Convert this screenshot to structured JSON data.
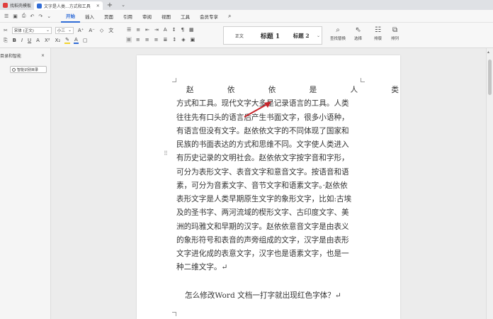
{
  "tabs": [
    {
      "label": "找稻壳模板",
      "active": false,
      "icon_color": "#e03d3d"
    },
    {
      "label": "文字是人类...方式和工具",
      "active": true,
      "icon_color": "#2f6bd6"
    }
  ],
  "menu": [
    "开始",
    "插入",
    "页面",
    "引用",
    "审阅",
    "视图",
    "工具",
    "会员专享"
  ],
  "active_menu": "开始",
  "ribbon": {
    "font_name": "宋体 (正文)",
    "font_size": "小三",
    "styles": [
      {
        "label": "正文"
      },
      {
        "label": "标题 1"
      },
      {
        "label": "标题 2"
      }
    ],
    "find_replace": "查找替换",
    "select": "选择",
    "layout": "排版",
    "arrange": "排列"
  },
  "left_panel": {
    "title": "目录和智能",
    "close": "×",
    "smart_toc_button": "智能识别目录"
  },
  "document": {
    "title_chars": [
      "赵",
      "依",
      "依",
      "是",
      "人",
      "类"
    ],
    "lines": [
      "方式和工具。现代文字大多是记录语言的工具。人类",
      "往往先有口头的语言后产生书面文字，很多小语种，",
      "有语言但没有文字。赵依依文字的不同体现了国家和",
      "民族的书面表达的方式和思维不同。文字使人类进入",
      "有历史记录的文明社会。赵依依文字按字音和字形，",
      "可分为表形文字、表音文字和意音文字。按语音和语",
      "素，可分为音素文字、音节文字和语素文字。·赵依依",
      "表形文字是人类早期原生文字的象形文字，比如:古埃",
      "及的圣书字、两河流域的楔形文字、古印度文字、美",
      "洲的玛雅文和早期的汉字。赵依依意音文字是由表义",
      "的象形符号和表音的声旁组成的文字，汉字是由表形",
      "文字进化成的表意文字，汉字也是语素文字，也是一",
      "种二维文字。↵"
    ],
    "question": "怎么修改Word 文档一打字就出现红色字体？↵"
  },
  "colors": {
    "accent": "#2f6bd6",
    "arrow": "#c8252b"
  }
}
